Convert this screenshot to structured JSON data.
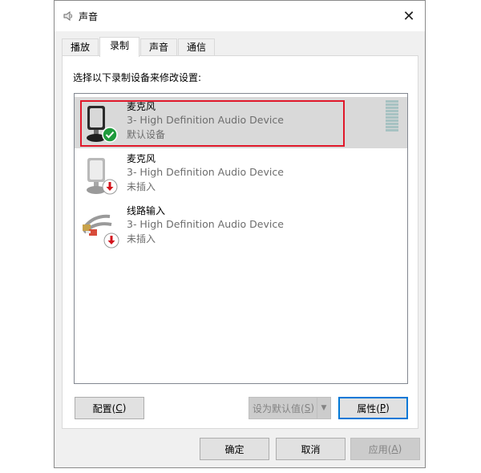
{
  "window": {
    "title": "声音",
    "close_glyph": "✕"
  },
  "tabs": [
    {
      "label": "播放",
      "active": false
    },
    {
      "label": "录制",
      "active": true
    },
    {
      "label": "声音",
      "active": false
    },
    {
      "label": "通信",
      "active": false
    }
  ],
  "panel": {
    "instruction": "选择以下录制设备来修改设置:"
  },
  "devices": [
    {
      "name": "麦克风",
      "description": "3- High Definition Audio Device",
      "status": "默认设备",
      "icon": "microphone-default-icon",
      "badge": "check-badge-icon",
      "selected": true
    },
    {
      "name": "麦克风",
      "description": "3- High Definition Audio Device",
      "status": "未插入",
      "icon": "microphone-icon",
      "badge": "unplugged-badge-icon",
      "selected": false
    },
    {
      "name": "线路输入",
      "description": "3- High Definition Audio Device",
      "status": "未插入",
      "icon": "line-in-cable-icon",
      "badge": "unplugged-badge-icon",
      "selected": false
    }
  ],
  "buttons": {
    "configure": {
      "label": "配置(",
      "key": "C",
      "suffix": ")"
    },
    "set_default": {
      "label": "设为默认值(",
      "key": "S",
      "suffix": ")"
    },
    "properties": {
      "label": "属性(",
      "key": "P",
      "suffix": ")"
    },
    "ok": "确定",
    "cancel": "取消",
    "apply": {
      "label": "应用(",
      "key": "A",
      "suffix": ")"
    }
  },
  "colors": {
    "selection_outline": "#e0182a",
    "selected_row": "#d9d9d9",
    "check_badge": "#1e9b3c",
    "unplugged_badge": "#d3141c",
    "primary_button_border": "#0078d7"
  }
}
